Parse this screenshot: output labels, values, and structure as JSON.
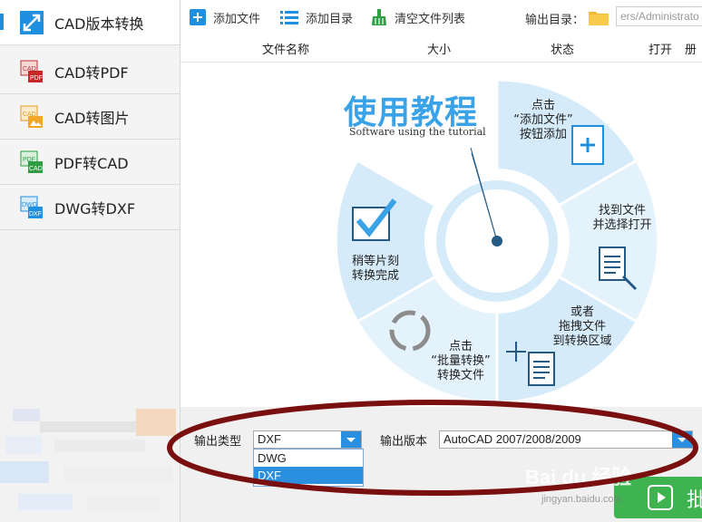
{
  "sidebar": {
    "items": [
      {
        "label": "CAD版本转换",
        "icon": "cad-version-icon",
        "active": true
      },
      {
        "label": "CAD转PDF",
        "icon": "cad-pdf-icon",
        "active": false
      },
      {
        "label": "CAD转图片",
        "icon": "cad-image-icon",
        "active": false
      },
      {
        "label": "PDF转CAD",
        "icon": "pdf-cad-icon",
        "active": false
      },
      {
        "label": "DWG转DXF",
        "icon": "dwg-dxf-icon",
        "active": false
      }
    ]
  },
  "toolbar": {
    "add_file": "添加文件",
    "add_folder": "添加目录",
    "clear_list": "清空文件列表",
    "output_label": "输出目录：",
    "output_path": "ers/Administrato"
  },
  "table": {
    "columns": [
      "文件名称",
      "大小",
      "状态",
      "打开",
      "册"
    ]
  },
  "tutorial": {
    "title": "使用教程",
    "subtitle": "Software using the tutorial",
    "steps": [
      {
        "lines": [
          "点击",
          "“添加文件”",
          "按钮添加"
        ]
      },
      {
        "lines": [
          "找到文件",
          "并选择打开"
        ]
      },
      {
        "lines": [
          "或者",
          "拖拽文件",
          "到转换区域"
        ]
      },
      {
        "lines": [
          "点击",
          "“批量转换”",
          "转换文件"
        ]
      },
      {
        "lines": [
          "稍等片刻",
          "转换完成"
        ]
      }
    ]
  },
  "bottom": {
    "output_type_label": "输出类型",
    "output_type_value": "DXF",
    "output_type_options": [
      "DWG",
      "DXF"
    ],
    "output_version_label": "输出版本",
    "output_version_value": "AutoCAD 2007/2008/2009",
    "convert_label": "批"
  },
  "watermark": {
    "text": "Bai du 经验",
    "sub": "jingyan.baidu.com"
  },
  "colors": {
    "accent": "#2b8fe0",
    "wheel": "#e3f1fb",
    "wheel_dark": "#cfe7f8",
    "annotation": "#7a0f0f",
    "convert": "#3fb34f"
  }
}
